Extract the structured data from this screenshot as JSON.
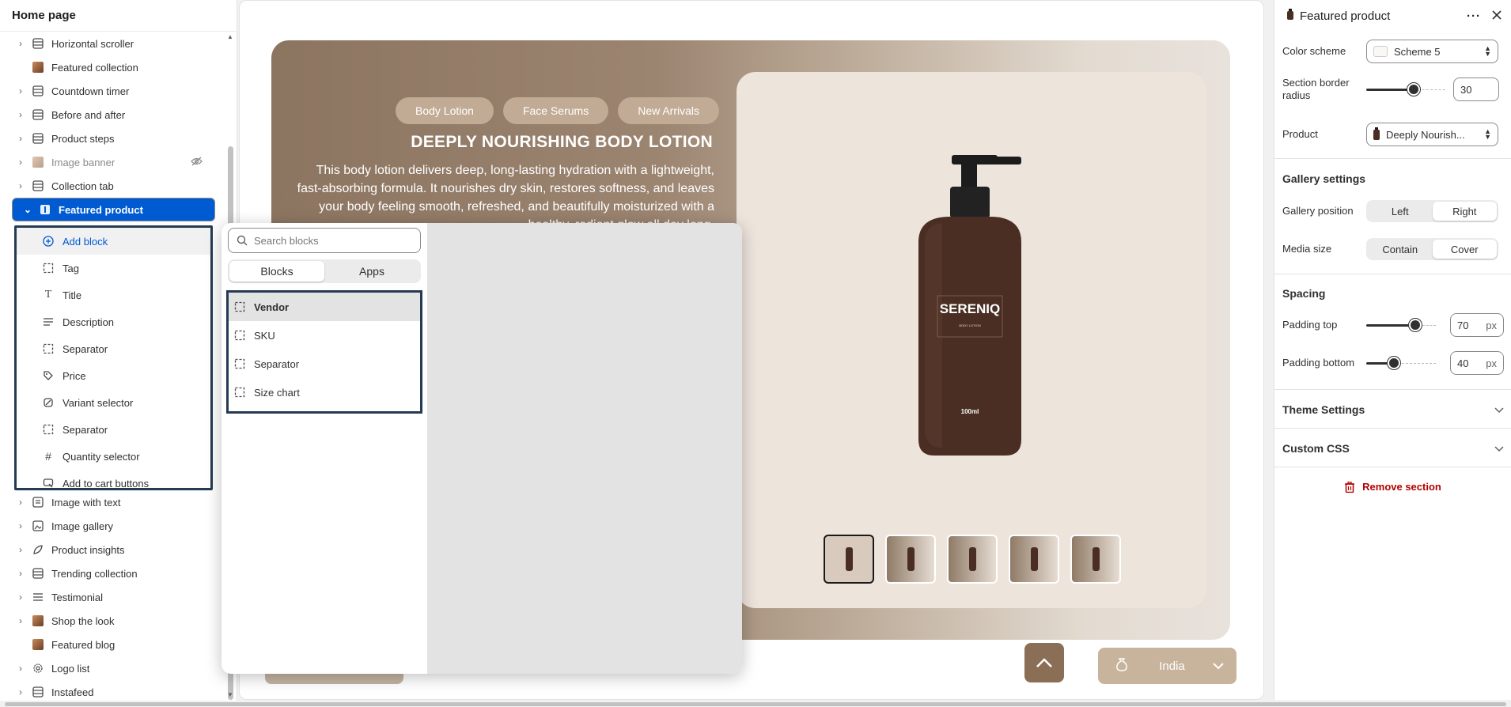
{
  "left_panel": {
    "title": "Home page",
    "sections": [
      {
        "label": "Horizontal scroller",
        "icon": "section-icon",
        "chevron": true
      },
      {
        "label": "Featured collection",
        "icon": "image-thumb",
        "chevron": false
      },
      {
        "label": "Countdown timer",
        "icon": "section-icon",
        "chevron": true
      },
      {
        "label": "Before and after",
        "icon": "section-icon",
        "chevron": true
      },
      {
        "label": "Product steps",
        "icon": "section-icon",
        "chevron": true
      },
      {
        "label": "Image banner",
        "icon": "image-thumb",
        "chevron": true,
        "hidden": true
      },
      {
        "label": "Collection tab",
        "icon": "section-icon",
        "chevron": true
      },
      {
        "label": "Featured product",
        "icon": "product-icon",
        "chevron": true,
        "selected": true
      }
    ],
    "blocks": {
      "add_label": "Add block",
      "items": [
        {
          "label": "Tag",
          "icon": "dashed-square-icon"
        },
        {
          "label": "Title",
          "icon": "text-t-icon"
        },
        {
          "label": "Description",
          "icon": "text-lines-icon"
        },
        {
          "label": "Separator",
          "icon": "dashed-square-icon"
        },
        {
          "label": "Price",
          "icon": "price-tag-icon"
        },
        {
          "label": "Variant selector",
          "icon": "variant-icon"
        },
        {
          "label": "Separator",
          "icon": "dashed-square-icon"
        },
        {
          "label": "Quantity selector",
          "icon": "hash-icon"
        },
        {
          "label": "Add to cart buttons",
          "icon": "cart-button-icon"
        }
      ]
    },
    "sections_after": [
      {
        "label": "Image with text",
        "icon": "section-icon",
        "chevron": true
      },
      {
        "label": "Image gallery",
        "icon": "gallery-icon",
        "chevron": true
      },
      {
        "label": "Product insights",
        "icon": "leaf-icon",
        "chevron": true
      },
      {
        "label": "Trending collection",
        "icon": "section-icon",
        "chevron": true
      },
      {
        "label": "Testimonial",
        "icon": "list-icon",
        "chevron": true
      },
      {
        "label": "Shop the look",
        "icon": "image-thumb",
        "chevron": true
      },
      {
        "label": "Featured blog",
        "icon": "image-thumb",
        "chevron": false
      },
      {
        "label": "Logo list",
        "icon": "gear-icon",
        "chevron": true
      },
      {
        "label": "Instafeed",
        "icon": "section-icon",
        "chevron": true
      }
    ]
  },
  "block_picker": {
    "search_placeholder": "Search blocks",
    "tabs": [
      "Blocks",
      "Apps"
    ],
    "active_tab": "Blocks",
    "items": [
      "Vendor",
      "SKU",
      "Separator",
      "Size chart"
    ],
    "active_item": "Vendor"
  },
  "preview": {
    "pills": [
      "Body Lotion",
      "Face Serums",
      "New Arrivals"
    ],
    "product_title": "DEEPLY NOURISHING BODY LOTION",
    "description": "This body lotion delivers deep, long-lasting hydration with a lightweight, fast-absorbing formula. It nourishes dry skin, restores softness, and leaves your body feeling smooth, refreshed, and beautifully moisturized with a healthy, radiant glow all day long.",
    "brand_on_bottle": "SERENIQ",
    "bottle_sublabel": "BODY LOTION",
    "bottle_volume": "100ml",
    "mobile_label": "mobile-preview",
    "country": "India",
    "thumbnail_count": 5
  },
  "right_panel": {
    "title": "Featured product",
    "color_scheme_label": "Color scheme",
    "color_scheme_value": "Scheme 5",
    "border_radius_label": "Section border radius",
    "border_radius_value": "30",
    "border_radius_fraction": 0.6,
    "product_label": "Product",
    "product_value": "Deeply Nourish...",
    "gallery_settings": "Gallery settings",
    "gallery_position_label": "Gallery position",
    "gallery_position_options": [
      "Left",
      "Right"
    ],
    "gallery_position_selected": "Right",
    "media_size_label": "Media size",
    "media_size_options": [
      "Contain",
      "Cover"
    ],
    "media_size_selected": "Cover",
    "spacing": "Spacing",
    "padding_top_label": "Padding top",
    "padding_top_value": "70",
    "padding_top_fraction": 0.7,
    "padding_bottom_label": "Padding bottom",
    "padding_bottom_value": "40",
    "padding_bottom_fraction": 0.4,
    "unit": "px",
    "theme_settings": "Theme Settings",
    "custom_css": "Custom CSS",
    "remove_section": "Remove section"
  },
  "colors": {
    "accent": "#005bd3",
    "danger": "#b30000",
    "hero_brown": "#8c7560",
    "pill": "#c2ab95",
    "bottle": "#4a2e24"
  }
}
